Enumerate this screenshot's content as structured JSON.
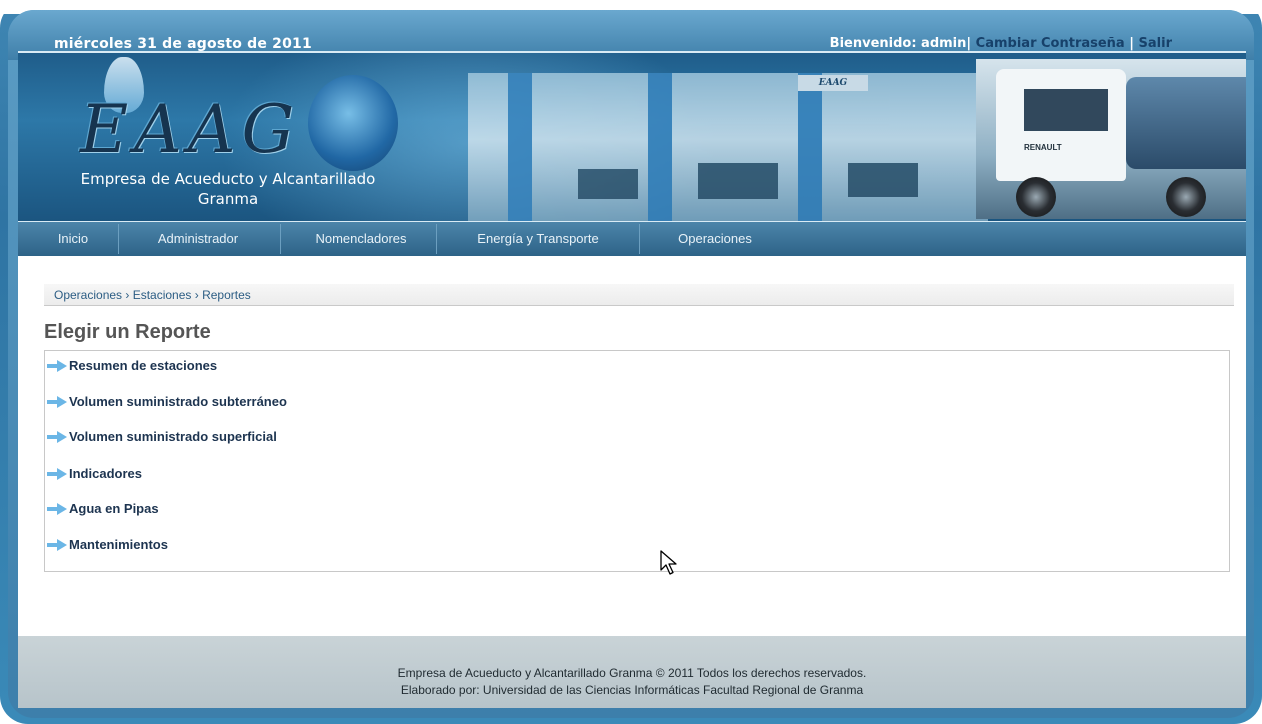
{
  "topbar": {
    "date": "miércoles 31 de agosto de 2011",
    "welcome_prefix": "Bienvenido: admin|",
    "change_password": "Cambiar Contraseña",
    "separator": "|",
    "logout": "Salir"
  },
  "banner": {
    "logo_text": "EAAG",
    "company_line1": "Empresa de Acueducto y Alcantarillado",
    "company_line2": "Granma",
    "building_sign": "EAAG",
    "truck_brand": "RENAULT"
  },
  "nav": {
    "items": [
      {
        "label": "Inicio"
      },
      {
        "label": "Administrador"
      },
      {
        "label": "Nomencladores"
      },
      {
        "label": "Energía y Transporte"
      },
      {
        "label": "Operaciones"
      }
    ]
  },
  "breadcrumb": "Operaciones › Estaciones › Reportes",
  "main": {
    "title": "Elegir un Reporte",
    "reports": [
      {
        "label": "Resumen de estaciones"
      },
      {
        "label": "Volumen suministrado subterráneo"
      },
      {
        "label": "Volumen suministrado superficial"
      },
      {
        "label": "Indicadores"
      },
      {
        "label": "Agua en Pipas"
      },
      {
        "label": "Mantenimientos"
      }
    ]
  },
  "footer": {
    "line1": "Empresa de Acueducto y Alcantarillado Granma © 2011 Todos los derechos reservados.",
    "line2": "Elaborado por: Universidad de las Ciencias Informáticas Facultad Regional de Granma"
  },
  "colors": {
    "frame": "#3a84b4",
    "link": "#17416a",
    "report_text": "#1d3450",
    "arrow": "#5aaee0"
  },
  "icons": {
    "report_item": "arrow-right-icon",
    "cursor": "mouse-pointer-icon"
  }
}
